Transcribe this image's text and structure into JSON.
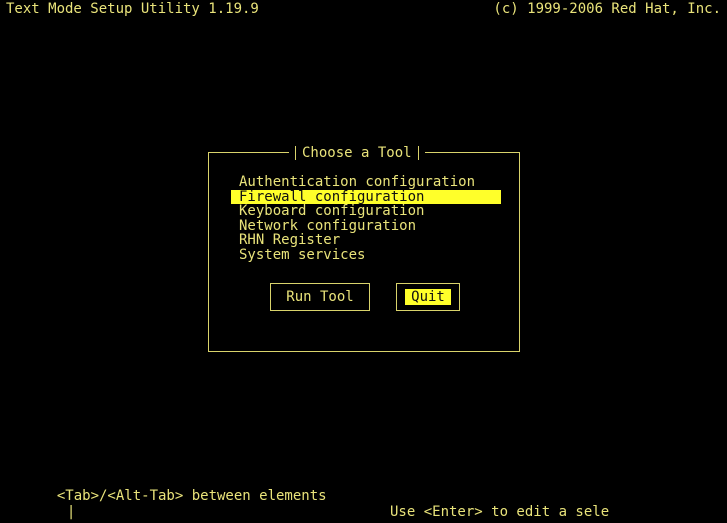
{
  "header": {
    "title": "Text Mode Setup Utility 1.19.9",
    "copyright": "(c) 1999-2006 Red Hat, Inc."
  },
  "dialog": {
    "title": "Choose a Tool",
    "items": [
      "Authentication configuration",
      "Firewall configuration",
      "Keyboard configuration",
      "Network configuration",
      "RHN Register",
      "System services"
    ],
    "selected_index": 1,
    "buttons": {
      "run": "Run Tool",
      "quit": "Quit"
    }
  },
  "footer": {
    "left": "<Tab>/<Alt-Tab> between elements",
    "separator": "|",
    "right": "Use <Enter> to edit a sele"
  },
  "colors": {
    "background": "#000000",
    "text": "#e9e37a",
    "highlight": "#ffff2a"
  }
}
